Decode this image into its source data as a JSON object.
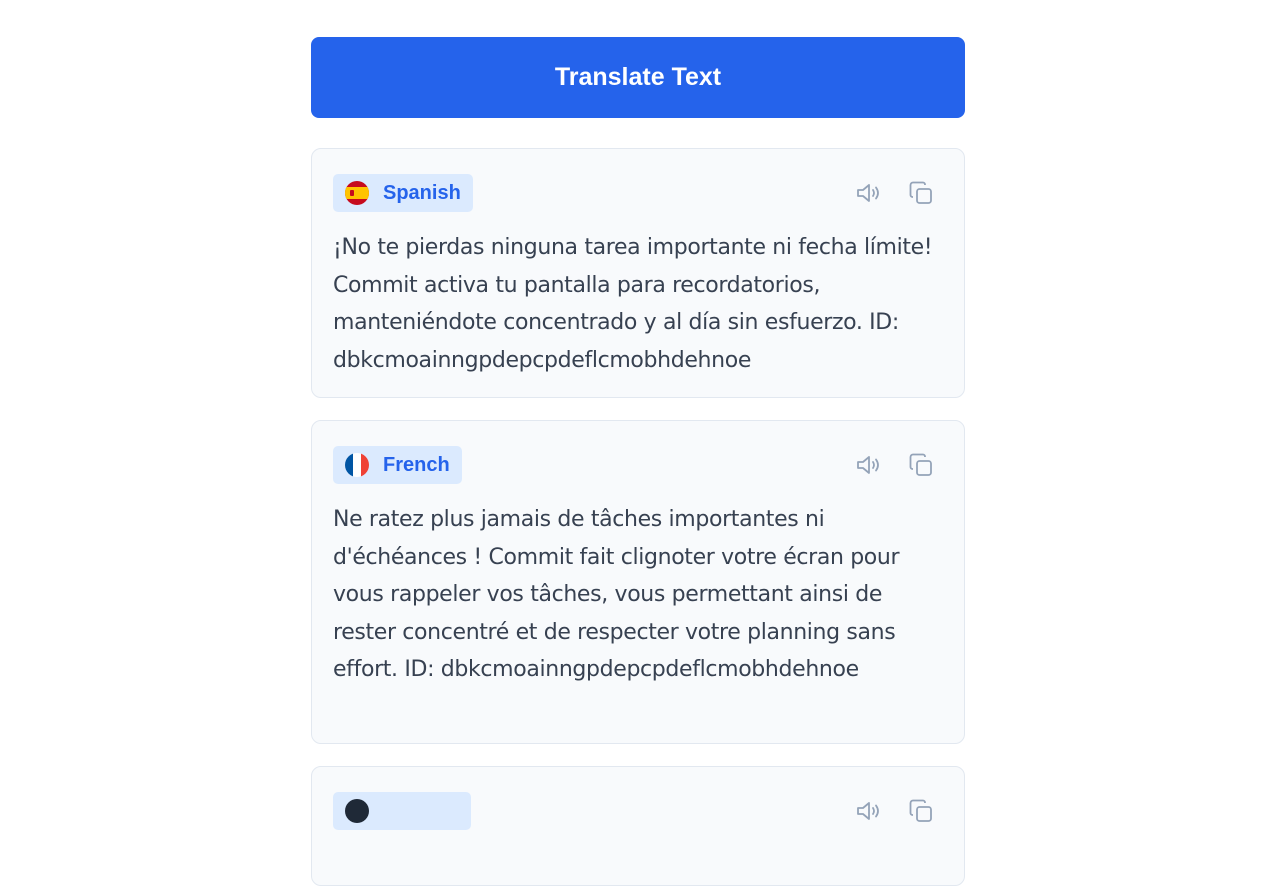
{
  "translate_button": {
    "label": "Translate Text"
  },
  "cards": [
    {
      "language": "Spanish",
      "flag": "spain-flag-icon",
      "text": "¡No te pierdas ninguna tarea importante ni fecha límite! Commit activa tu pantalla para recordatorios, manteniéndote concentrado y al día sin esfuerzo. ID: dbkcmoainngpdepcpdeflcmobhdehnoe"
    },
    {
      "language": "French",
      "flag": "france-flag-icon",
      "text": "Ne ratez plus jamais de tâches importantes ni d'échéances ! Commit fait clignoter votre écran pour vous rappeler vos tâches, vous permettant ainsi de rester concentré et de respecter votre planning sans effort. ID: dbkcmoainngpdepcpdeflcmobhdehnoe"
    }
  ],
  "colors": {
    "accent": "#2563eb",
    "badge_bg": "#dbeafe",
    "card_bg": "#f8fafc",
    "card_border": "#e2e8f0",
    "text": "#374151",
    "icon": "#94a3b8"
  },
  "icons": [
    "speaker-icon",
    "copy-icon"
  ]
}
